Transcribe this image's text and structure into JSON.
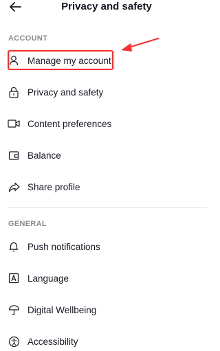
{
  "header": {
    "title": "Privacy and safety",
    "back_icon": "back-arrow-icon"
  },
  "sections": [
    {
      "label": "ACCOUNT",
      "items": [
        {
          "label": "Manage my account",
          "icon": "person-icon"
        },
        {
          "label": "Privacy and safety",
          "icon": "lock-icon"
        },
        {
          "label": "Content preferences",
          "icon": "video-icon"
        },
        {
          "label": "Balance",
          "icon": "wallet-icon"
        },
        {
          "label": "Share profile",
          "icon": "share-icon"
        }
      ]
    },
    {
      "label": "GENERAL",
      "items": [
        {
          "label": "Push notifications",
          "icon": "bell-icon"
        },
        {
          "label": "Language",
          "icon": "language-icon"
        },
        {
          "label": "Digital Wellbeing",
          "icon": "umbrella-icon"
        },
        {
          "label": "Accessibility",
          "icon": "accessibility-icon"
        }
      ]
    }
  ],
  "annotation": {
    "color": "#ff2d2d"
  }
}
